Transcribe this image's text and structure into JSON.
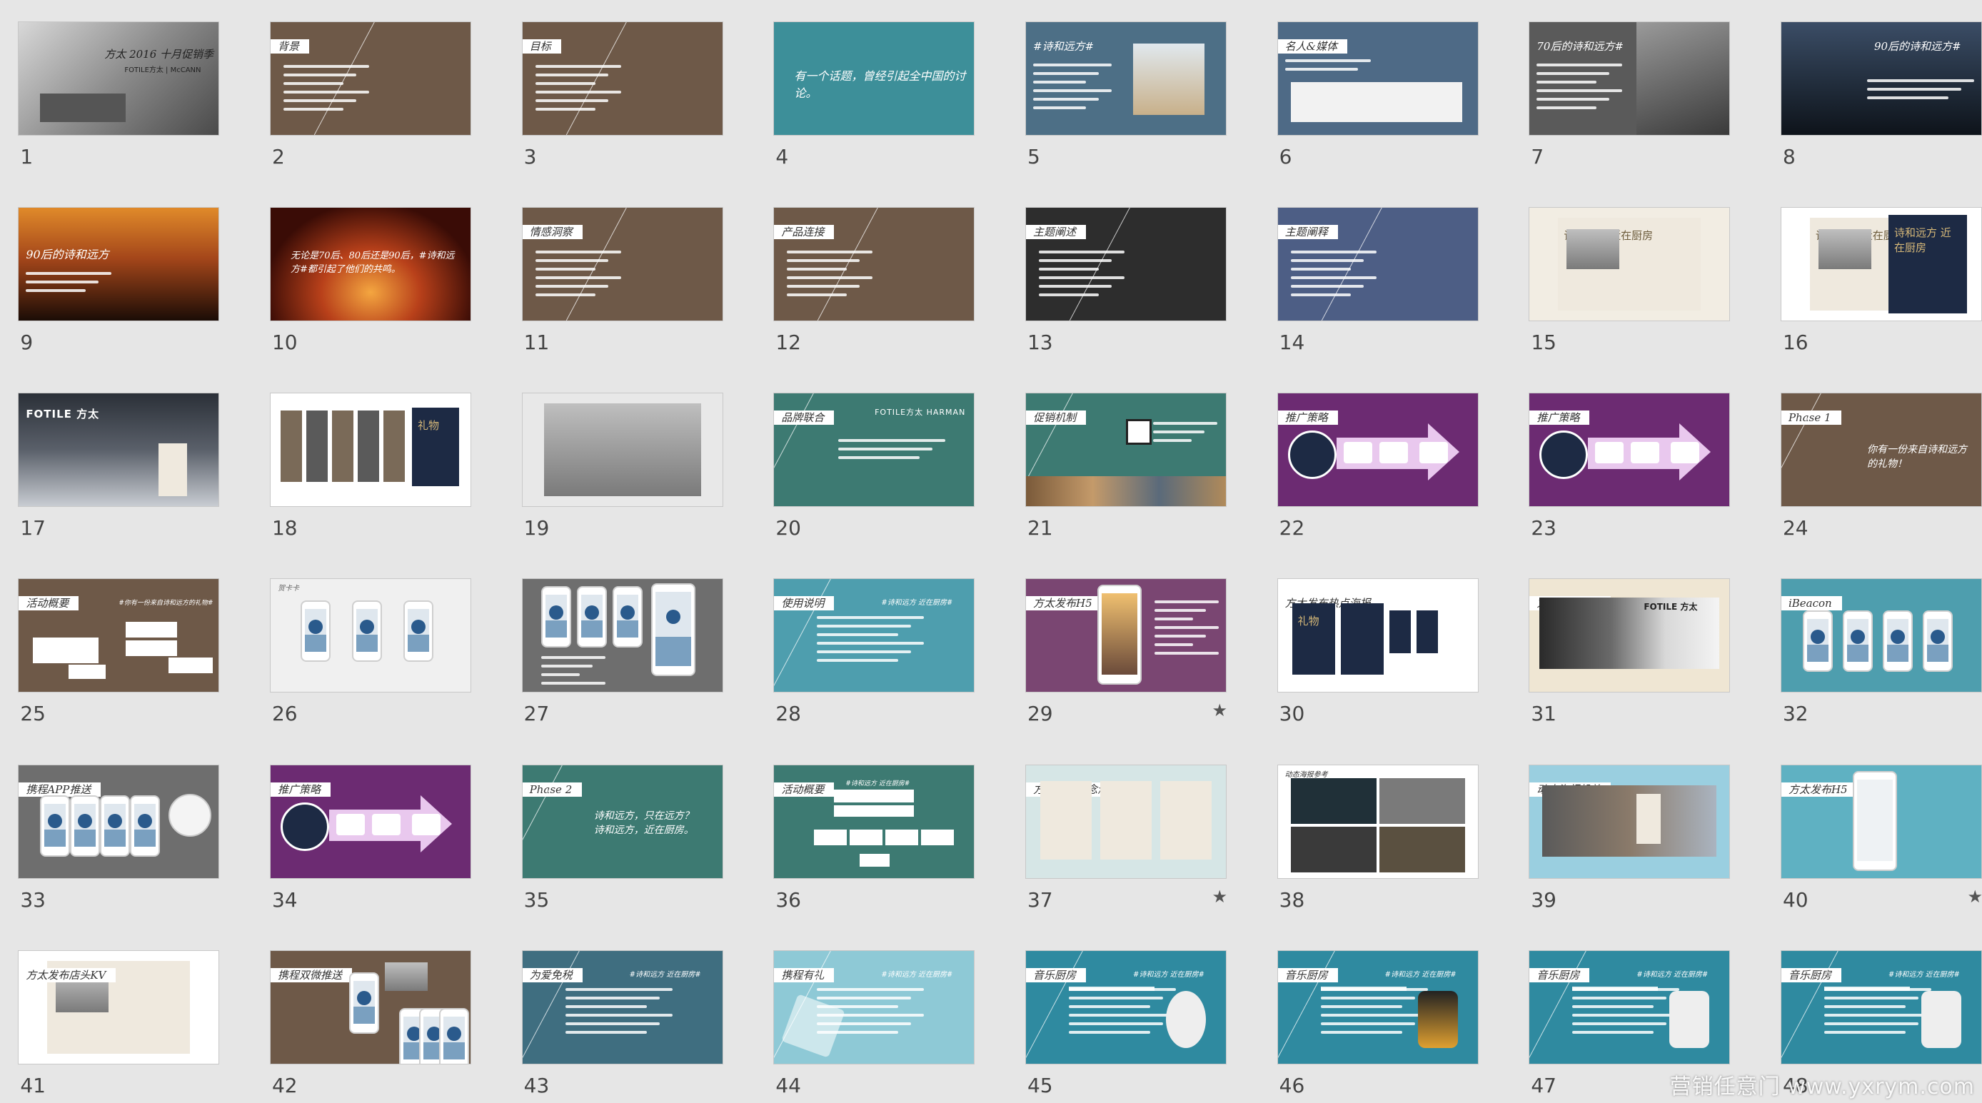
{
  "view": "slide-sorter",
  "slides": [
    {
      "number": "1",
      "title": "方太 2016 十月促销季",
      "subtitle": "FOTILE方太 | McCANN",
      "bg": "#6f6f6f",
      "star": false
    },
    {
      "number": "2",
      "tag": "背景",
      "bg": "#6e5948",
      "star": false
    },
    {
      "number": "3",
      "tag": "目标",
      "bg": "#6e5948",
      "star": false
    },
    {
      "number": "4",
      "body": "有一个话题，曾经引起全中国的讨论。",
      "bg": "#3d8f99",
      "star": false
    },
    {
      "number": "5",
      "tag": "#诗和远方#",
      "bg": "#4d6f86",
      "star": false
    },
    {
      "number": "6",
      "tag": "名人&媒体",
      "bg": "#4e6a86",
      "star": false
    },
    {
      "number": "7",
      "tag": "70后的诗和远方#",
      "bg": "#5a5a5a",
      "star": false
    },
    {
      "number": "8",
      "tag": "90后的诗和远方#",
      "bg": "#28384c",
      "star": false
    },
    {
      "number": "9",
      "tag": "90后的诗和远方",
      "bg": "#8a4412",
      "star": false
    },
    {
      "number": "10",
      "body": "无论是70后、80后还是90后，#诗和远方#都引起了他们的共鸣。",
      "bg": "#5a1e10",
      "star": false
    },
    {
      "number": "11",
      "tag": "情感洞察",
      "bg": "#6e5948",
      "star": false
    },
    {
      "number": "12",
      "tag": "产品连接",
      "bg": "#6e5948",
      "star": false
    },
    {
      "number": "13",
      "tag": "主题阐述",
      "bg": "#2d2d2d",
      "star": false
    },
    {
      "number": "14",
      "tag": "主题阐释",
      "bg": "#4d5e85",
      "star": false
    },
    {
      "number": "15",
      "poster": "诗和远方 近在厨房",
      "bg": "#f2ede3",
      "star": false
    },
    {
      "number": "16",
      "poster": "诗和远方 近在厨房",
      "bg": "#ffffff",
      "star": false
    },
    {
      "number": "17",
      "logo": "FOTILE 方太",
      "bg": "#3a3f46",
      "star": false
    },
    {
      "number": "18",
      "poster": "礼物",
      "bg": "#ffffff",
      "star": false
    },
    {
      "number": "19",
      "bg": "#e8e8e8",
      "star": false
    },
    {
      "number": "20",
      "tag": "品牌联合",
      "logo": "FOTILE方太 HARMAN",
      "bg": "#3d7a72",
      "star": false
    },
    {
      "number": "21",
      "tag": "促销机制",
      "bg": "#3d7a72",
      "star": false
    },
    {
      "number": "22",
      "tag": "推广策略",
      "bg": "#6c2b72",
      "star": false
    },
    {
      "number": "23",
      "tag": "推广策略",
      "bg": "#6c2b72",
      "star": false
    },
    {
      "number": "24",
      "tag": "Phase 1",
      "body": "你有一份来自诗和远方的礼物！",
      "bg": "#6e5948",
      "star": false
    },
    {
      "number": "25",
      "tag": "活动概要",
      "body": "#你有一份来自诗和远方的礼物#",
      "bg": "#6e5948",
      "star": false
    },
    {
      "number": "26",
      "tag": "贺卡卡",
      "bg": "#f0f0f0",
      "star": false
    },
    {
      "number": "27",
      "bg": "#6e6e6e",
      "star": false
    },
    {
      "number": "28",
      "tag": "使用说明",
      "body": "#诗和远方 近在厨房#",
      "bg": "#4e9eae",
      "star": false
    },
    {
      "number": "29",
      "tag": "方太发布H5",
      "bg": "#7a4672",
      "star": true
    },
    {
      "number": "30",
      "tag": "方太发布热点海报",
      "poster": "礼物",
      "bg": "#ffffff",
      "star": false
    },
    {
      "number": "31",
      "tag": "方太店头陈列",
      "logo": "FOTILE 方太",
      "bg": "#efe6d3",
      "star": false
    },
    {
      "number": "32",
      "tag": "iBeacon",
      "bg": "#4e9eae",
      "star": false
    },
    {
      "number": "33",
      "tag": "携程APP推送",
      "bg": "#6e6e6e",
      "star": false
    },
    {
      "number": "34",
      "tag": "推广策略",
      "bg": "#6c2b72",
      "star": false
    },
    {
      "number": "35",
      "tag": "Phase 2",
      "body": "诗和远方，只在远方？诗和远方，近在厨房。",
      "bg": "#3d7a72",
      "star": false
    },
    {
      "number": "36",
      "tag": "活动概要",
      "body": "#诗和远方 近在厨房#",
      "bg": "#3d7a72",
      "star": false
    },
    {
      "number": "37",
      "tag": "方太发布悬念海报",
      "bg": "#d6e6e6",
      "star": true
    },
    {
      "number": "38",
      "tag": "动态海报参考",
      "bg": "#ffffff",
      "star": false
    },
    {
      "number": "39",
      "tag": "动态海报投放",
      "bg": "#9acfe0",
      "star": false
    },
    {
      "number": "40",
      "tag": "方太发布H5",
      "bg": "#5fb1c2",
      "star": true
    },
    {
      "number": "41",
      "tag": "方太发布店头KV",
      "bg": "#ffffff",
      "star": false
    },
    {
      "number": "42",
      "tag": "携程双微推送",
      "bg": "#6e5948",
      "star": false
    },
    {
      "number": "43",
      "tag": "为爱免税",
      "body": "#诗和远方 近在厨房#",
      "bg": "#3f6e80",
      "star": false
    },
    {
      "number": "44",
      "tag": "携程有礼",
      "body": "#诗和远方 近在厨房#",
      "bg": "#8ec9d6",
      "star": false
    },
    {
      "number": "45",
      "tag": "音乐厨房",
      "body": "#诗和远方 近在厨房#",
      "bg": "#2f8aa0",
      "star": false
    },
    {
      "number": "46",
      "tag": "音乐厨房",
      "body": "#诗和远方 近在厨房#",
      "bg": "#2f8aa0",
      "star": false
    },
    {
      "number": "47",
      "tag": "音乐厨房",
      "body": "#诗和远方 近在厨房#",
      "bg": "#2f8aa0",
      "star": false
    },
    {
      "number": "48",
      "tag": "音乐厨房",
      "body": "#诗和远方 近在厨房#",
      "bg": "#2f8aa0",
      "star": false
    }
  ],
  "watermark": "营销任意门 www.yxrym.com"
}
